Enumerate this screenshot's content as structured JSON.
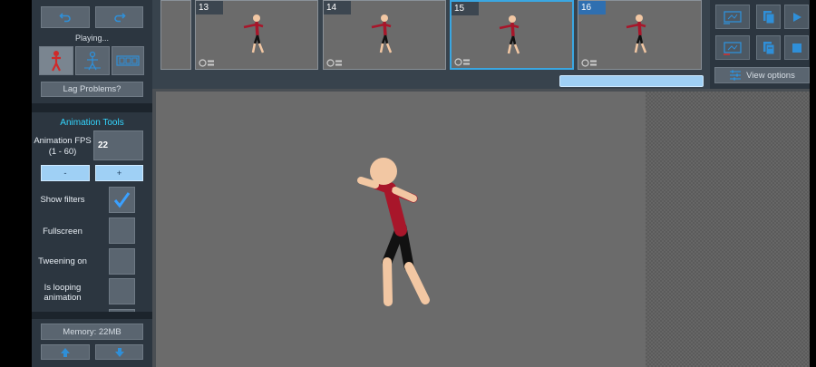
{
  "left_panel": {
    "status": "Playing...",
    "lag_button": "Lag Problems?",
    "tools_title": "Animation Tools",
    "fps_label": "Animation FPS\n(1 - 60)",
    "fps_label_line1": "Animation FPS",
    "fps_label_line2": "(1 - 60)",
    "fps_value": "22",
    "minus_label": "-",
    "plus_label": "+",
    "options": [
      {
        "label": "Show filters",
        "checked": true
      },
      {
        "label": "Fullscreen",
        "checked": false
      },
      {
        "label": "Tweening on",
        "checked": false
      },
      {
        "label_line1": "Is looping",
        "label_line2": "animation",
        "checked": false
      }
    ],
    "memory": "Memory: 22MB"
  },
  "timeline": {
    "frames": [
      "13",
      "14",
      "15",
      "16"
    ],
    "selected_frame": "15"
  },
  "right_panel": {
    "view_options": "View options"
  },
  "colors": {
    "accent": "#3aa7e2",
    "button_blue": "#9fd0f5",
    "tools_title": "#33d6ff",
    "shirt": "#a8162a",
    "skin": "#f2c7a3"
  }
}
